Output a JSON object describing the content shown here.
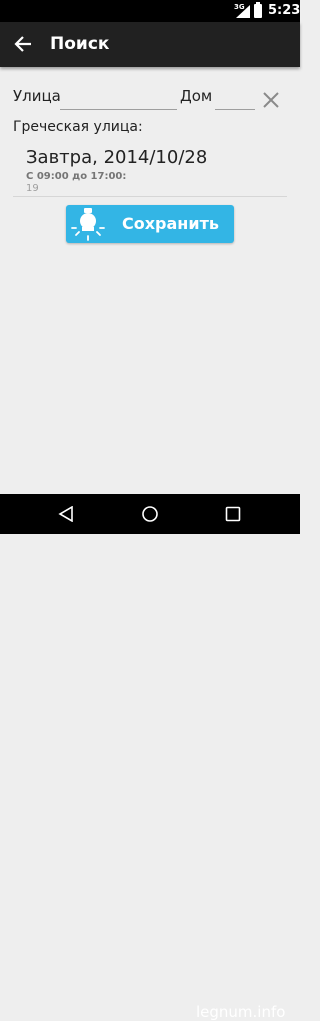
{
  "status_bar": {
    "network": "3G",
    "time": "5:23"
  },
  "app_bar": {
    "back_icon": "arrow-left-icon",
    "title": "Поиск"
  },
  "search_form": {
    "street_label": "Улица",
    "street_value": "",
    "house_label": "Дом",
    "house_value": "",
    "clear_icon": "close-icon"
  },
  "result": {
    "street_name": "Греческая улица:",
    "entries": [
      {
        "date": "Завтра, 2014/10/28",
        "hours": "С 09:00 до 17:00:",
        "number": "19"
      }
    ]
  },
  "save_button": {
    "label": "Сохранить",
    "icon": "lightbulb-icon",
    "color": "#33b5e5"
  },
  "nav_bar": {
    "back_icon": "triangle-back-icon",
    "home_icon": "circle-home-icon",
    "recent_icon": "square-recent-icon"
  },
  "watermark": "legnum.info"
}
